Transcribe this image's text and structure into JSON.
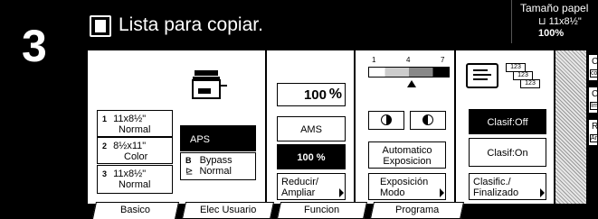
{
  "step": {
    "number": "3"
  },
  "header": {
    "title": "Lista para copiar.",
    "paper_label": "Tamaño papel",
    "paper_size": "11x8½\"",
    "zoom": "100%"
  },
  "paper": {
    "trays": [
      {
        "num": "1",
        "size": "11x8½\"",
        "type": "Normal"
      },
      {
        "num": "2",
        "size": "8½x11\"",
        "type": "Color"
      },
      {
        "num": "3",
        "size": "11x8½\"",
        "type": "Normal"
      }
    ],
    "aps_label": "APS",
    "bypass": {
      "letter": "B",
      "label": "Bypass",
      "type": "Normal"
    }
  },
  "zoom": {
    "value": "100",
    "unit": "%",
    "ams_label": "AMS",
    "preset_label": "100 %",
    "reduce_label": "Reducir/ Ampliar"
  },
  "exposure": {
    "scale_ticks": [
      "1",
      "4",
      "7"
    ],
    "level": 0.5,
    "auto_label": "Automatico Exposicion",
    "mode_label": "Exposición Modo"
  },
  "finishing": {
    "sort_off_label": "Clasif:Off",
    "sort_on_label": "Clasif:On",
    "finish_label": "Clasific./ Finalizado",
    "stack_labels": [
      "123",
      "123",
      "123"
    ]
  },
  "side_buttons": [
    {
      "label": "Co",
      "mark": "co"
    },
    {
      "label": "Ca",
      "mark": "Im"
    },
    {
      "label": "Re",
      "mark": "Ar"
    }
  ],
  "tabs": [
    {
      "label": "Basico"
    },
    {
      "label": "Elec Usuario"
    },
    {
      "label": "Funcion"
    },
    {
      "label": "Programa"
    }
  ]
}
